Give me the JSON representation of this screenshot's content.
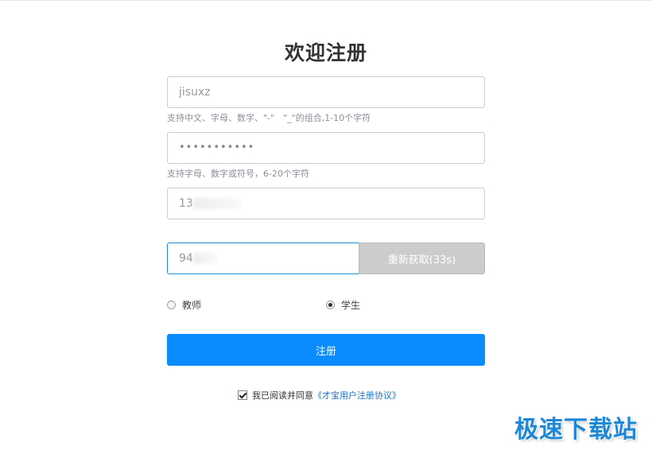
{
  "form": {
    "title": "欢迎注册",
    "username": {
      "value": "jisuxz",
      "hint": "支持中文、字母、数字、\"-\"　\"_\"的组合,1-10个字符"
    },
    "password": {
      "value": "•••••••••••",
      "hint": "支持字母、数字或符号，6-20个字符"
    },
    "phone": {
      "value_prefix": "13"
    },
    "code": {
      "value_prefix": "94",
      "button_label": "重新获取(33s)"
    },
    "roles": [
      {
        "label": "教师",
        "checked": false
      },
      {
        "label": "学生",
        "checked": true
      }
    ],
    "submit_label": "注册",
    "agreement": {
      "text": "我已阅读并同意",
      "link": "《才宝用户注册协议》",
      "checked": true
    }
  },
  "watermark": "极速下载站"
}
